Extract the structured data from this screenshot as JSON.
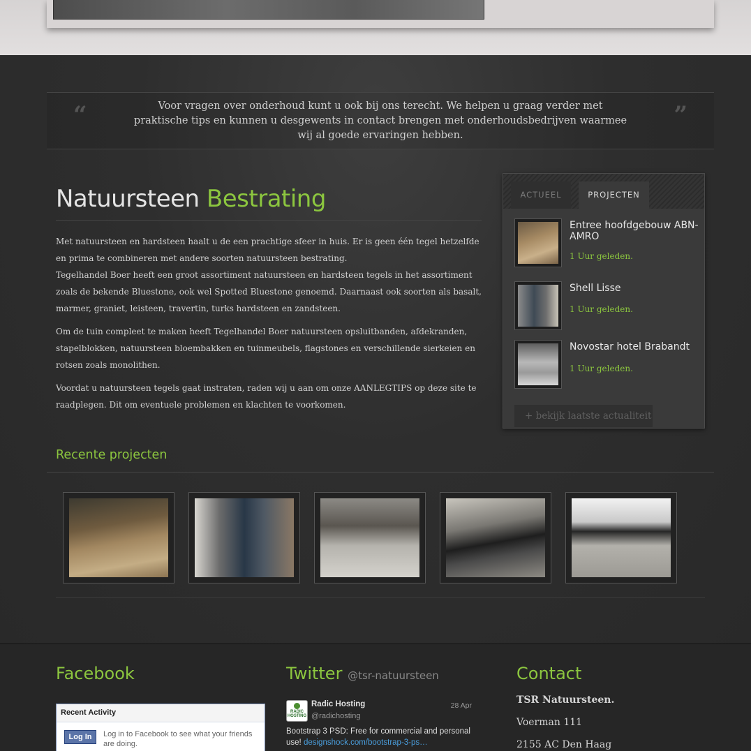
{
  "quote": {
    "open_mark": "“",
    "close_mark": "”",
    "text": "Voor vragen over onderhoud kunt u ook bij ons terecht. We helpen u graag verder met praktische tips en kunnen u desgewents in contact brengen met onderhoudsbedrijven waarmee wij al goede ervaringen hebben."
  },
  "article": {
    "title_main": "Natuursteen",
    "title_accent": "Bestrating",
    "paragraphs": [
      "Met natuursteen en hardsteen haalt u de een prachtige sfeer in huis. Er is geen één tegel hetzelfde en prima te combineren met andere soorten natuursteen bestrating.",
      "Tegelhandel Boer heeft een groot assortiment natuursteen en hardsteen tegels in het assortiment zoals de bekende Bluestone, ook wel Spotted Bluestone genoemd. Daarnaast ook soorten als basalt, marmer, graniet, leisteen, travertin, turks hardsteen en zandsteen.",
      "Om de tuin compleet te maken heeft Tegelhandel Boer natuursteen opsluitbanden, afdekranden, stapelblokken, natuursteen bloembakken en tuinmeubels, flagstones en verschillende sierkeien en rotsen zoals monolithen.",
      "Voordat u natuursteen tegels gaat instraten, raden wij u aan om onze AANLEGTIPS op deze site te raadplegen. Dit om eventuele problemen en klachten te voorkomen."
    ]
  },
  "widget": {
    "tabs": [
      "ACTUEEL",
      "PROJECTEN"
    ],
    "items": [
      {
        "title": "Entree hoofdgebouw ABN-AMRO",
        "time": "1 Uur geleden."
      },
      {
        "title": "Shell Lisse",
        "time": "1 Uur geleden."
      },
      {
        "title": "Novostar hotel Brabandt",
        "time": "1 Uur geleden."
      }
    ],
    "more_link": "+ bekijk laatste actualiteit"
  },
  "recent": {
    "title": "Recente projecten"
  },
  "footer": {
    "facebook": {
      "title": "Facebook",
      "box_header": "Recent Activity",
      "login_label": "Log In",
      "login_text": "Log in to Facebook to see what your friends are doing."
    },
    "twitter": {
      "title": "Twitter",
      "handle": "@tsr-natuursteen",
      "tweet": {
        "avatar_text": "RADIC HOSTING",
        "name": "Radic Hosting",
        "user": "@radichosting",
        "date": "28 Apr",
        "text": "Bootstrap 3 PSD: Free for commercial and personal use!",
        "link": "designshock.com/bootstrap-3-ps…"
      }
    },
    "contact": {
      "title": "Contact",
      "name": "TSR Natuursteen.",
      "street": "Voerman 111",
      "city": "2155 AC Den Haag"
    }
  },
  "colors": {
    "accent": "#8cc63f",
    "background": "#2b2b2b"
  }
}
